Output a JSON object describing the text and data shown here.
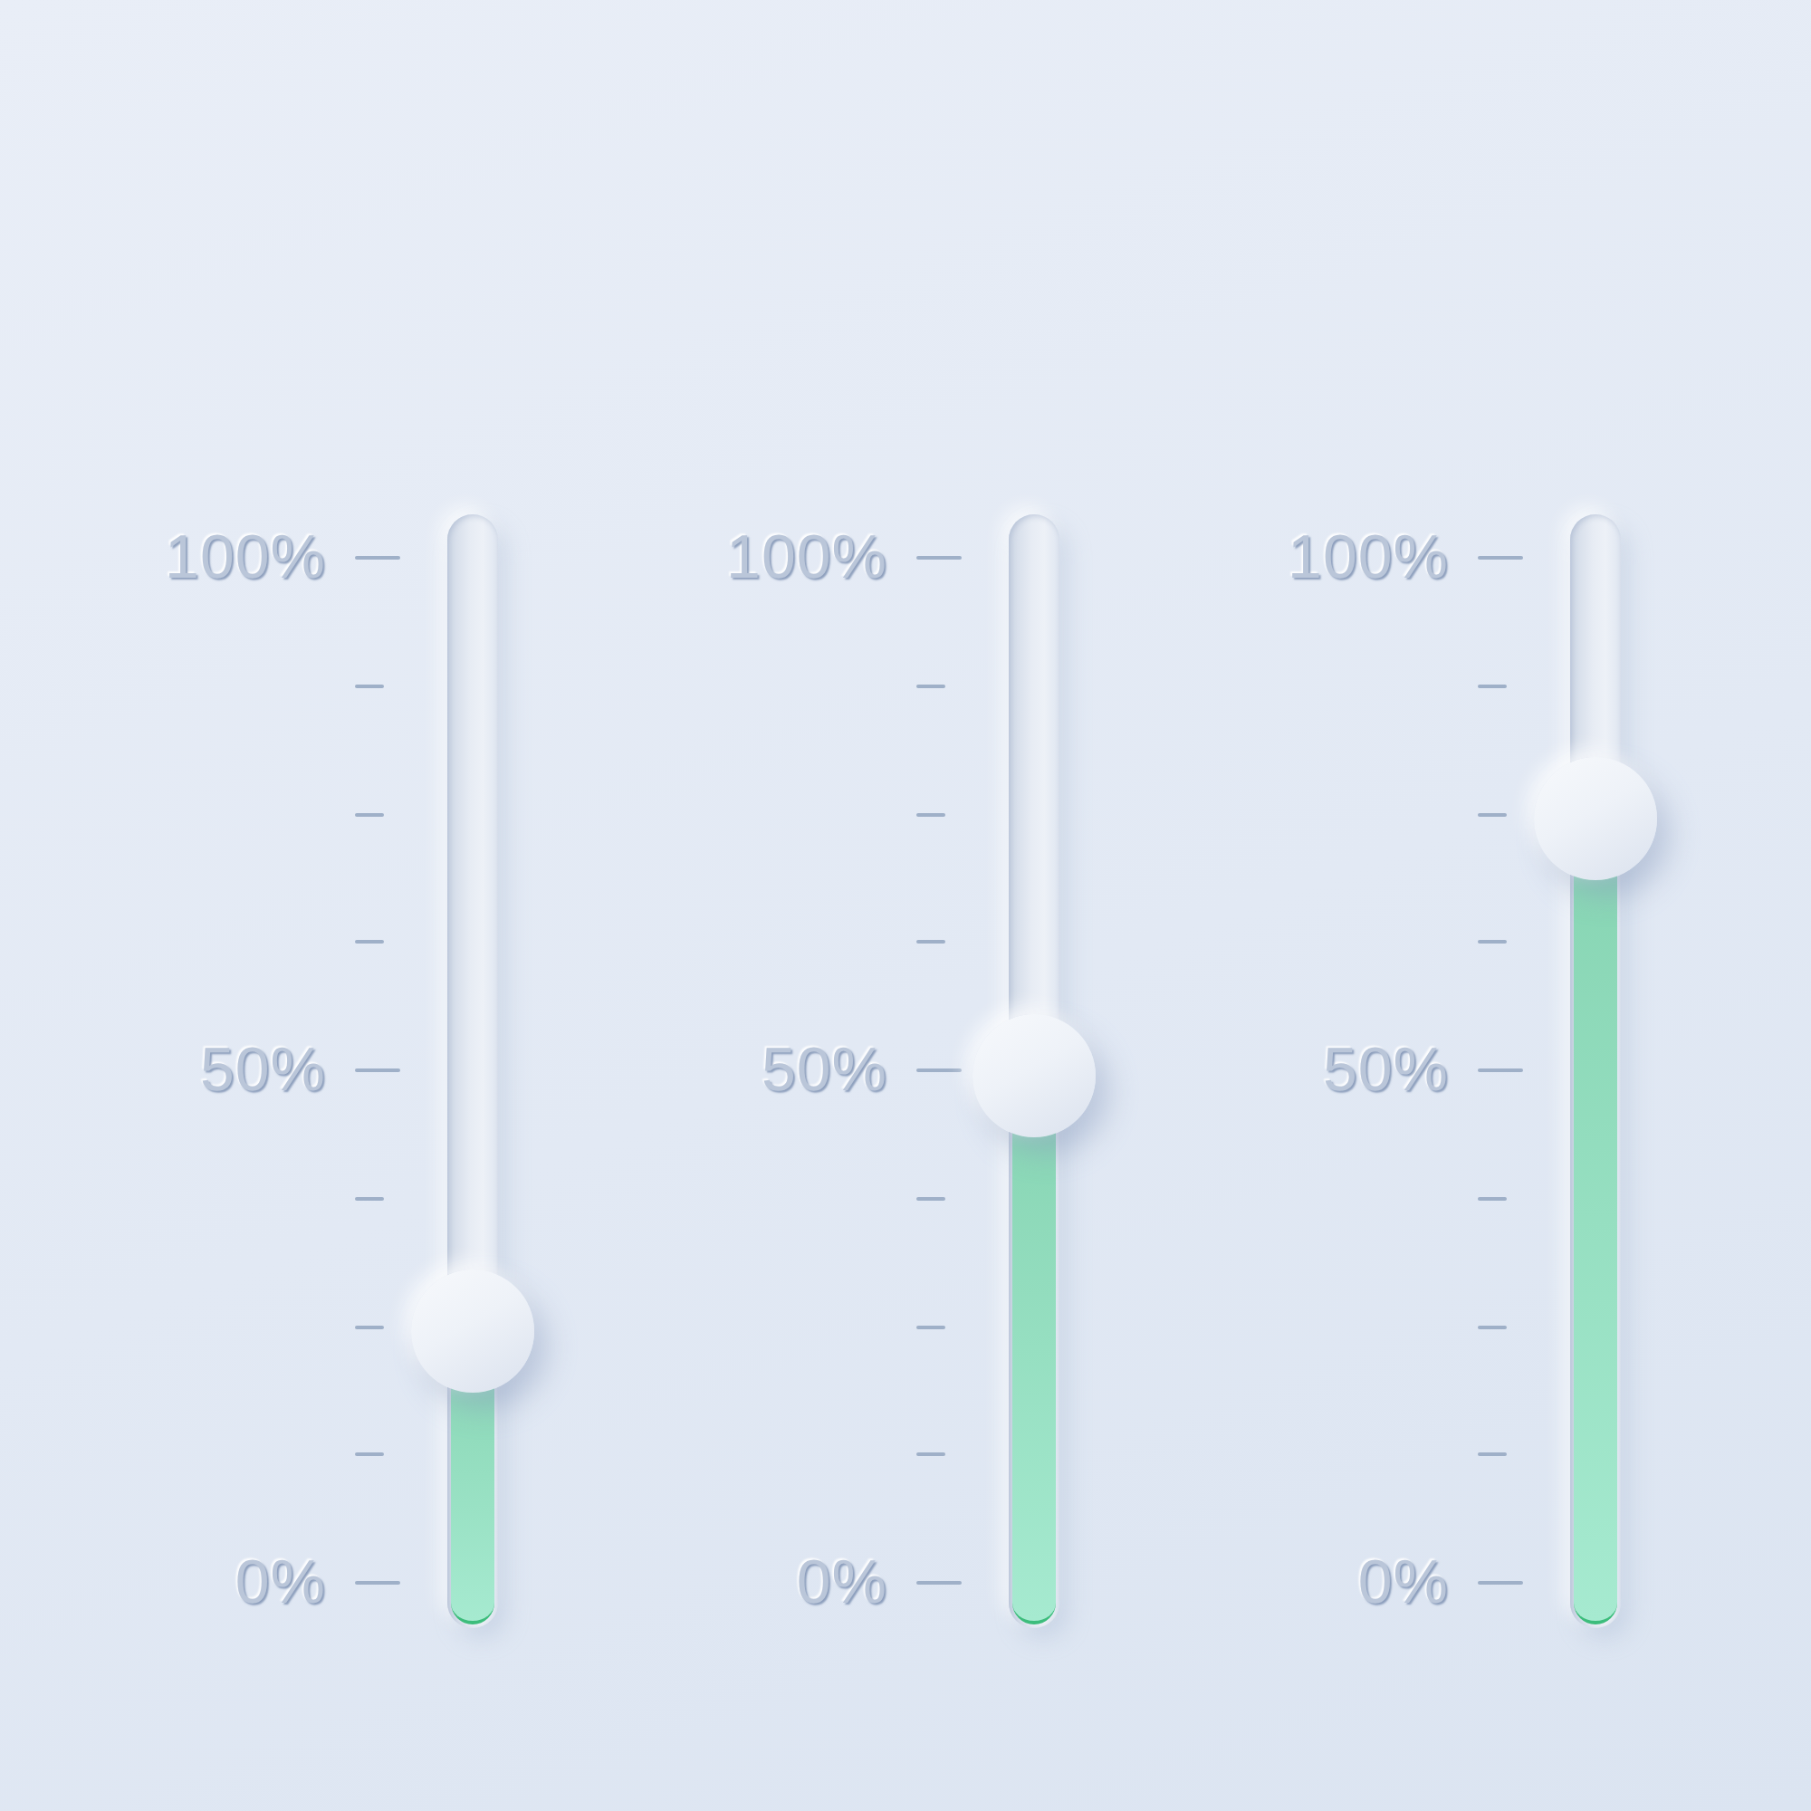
{
  "sliders": [
    {
      "level": 0.25,
      "scale_labels": [
        "100%",
        "50%",
        "0%"
      ]
    },
    {
      "level": 0.5,
      "scale_labels": [
        "100%",
        "50%",
        "0%"
      ]
    },
    {
      "level": 0.75,
      "scale_labels": [
        "100%",
        "50%",
        "0%"
      ]
    }
  ]
}
